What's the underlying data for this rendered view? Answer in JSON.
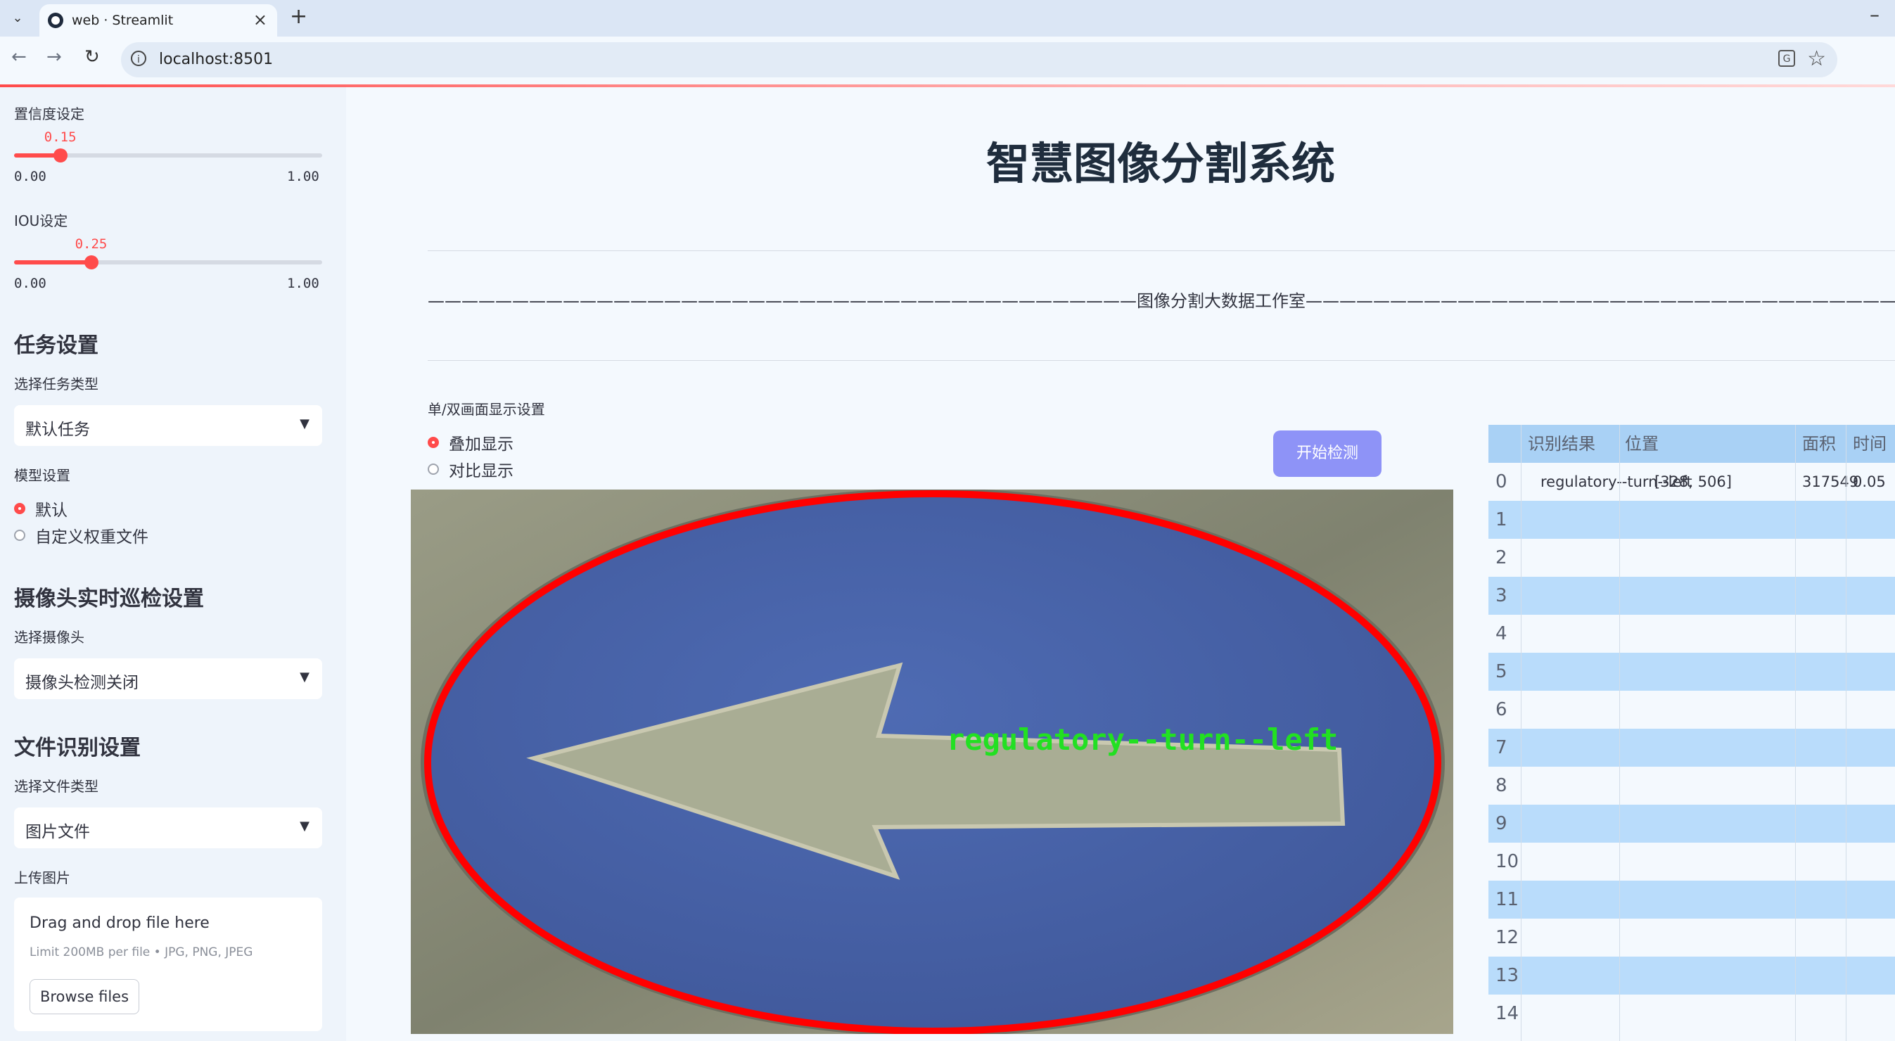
{
  "browser": {
    "tab_title": "web · Streamlit",
    "url": "localhost:8501"
  },
  "sidebar": {
    "confidence": {
      "label": "置信度设定",
      "value": "0.15",
      "value_num": 0.15,
      "min": "0.00",
      "max": "1.00"
    },
    "iou": {
      "label": "IOU设定",
      "value": "0.25",
      "value_num": 0.25,
      "min": "0.00",
      "max": "1.00"
    },
    "task_settings": {
      "heading": "任务设置",
      "select_label": "选择任务类型",
      "selected": "默认任务"
    },
    "model_settings": {
      "label": "模型设置",
      "options": [
        "默认",
        "自定义权重文件"
      ],
      "selected_index": 0
    },
    "camera": {
      "heading": "摄像头实时巡检设置",
      "select_label": "选择摄像头",
      "selected": "摄像头检测关闭"
    },
    "file": {
      "heading": "文件识别设置",
      "select_label": "选择文件类型",
      "selected": "图片文件"
    },
    "upload": {
      "label": "上传图片",
      "drop_text": "Drag and drop file here",
      "limit_text": "Limit 200MB per file • JPG, PNG, JPEG",
      "browse_label": "Browse files"
    }
  },
  "main": {
    "title": "智慧图像分割系统",
    "studio_line": "——————————————————————————————————————————图像分割大数据工作室——————————————————————————————————————————",
    "display_label": "单/双画面显示设置",
    "display_options": [
      "叠加显示",
      "对比显示"
    ],
    "display_selected_index": 0,
    "start_button": "开始检测",
    "detection_label": "regulatory--turn--left"
  },
  "results_table": {
    "headers": [
      "识别结果",
      "位置",
      "面积",
      "时间"
    ],
    "rows": [
      {
        "index": "0",
        "result": "regulatory--turn--left",
        "position": "[328, 506]",
        "area": "317549",
        "time": "0.05"
      },
      {
        "index": "1"
      },
      {
        "index": "2"
      },
      {
        "index": "3"
      },
      {
        "index": "4"
      },
      {
        "index": "5"
      },
      {
        "index": "6"
      },
      {
        "index": "7"
      },
      {
        "index": "8"
      },
      {
        "index": "9"
      },
      {
        "index": "10"
      },
      {
        "index": "11"
      },
      {
        "index": "12"
      },
      {
        "index": "13"
      },
      {
        "index": "14"
      }
    ]
  },
  "colors": {
    "accent": "#ff4b4b",
    "button": "#8e93f7",
    "table_stripe": "#b9dcfb",
    "mask_outline": "#ff0000",
    "label_text": "#22e022"
  }
}
